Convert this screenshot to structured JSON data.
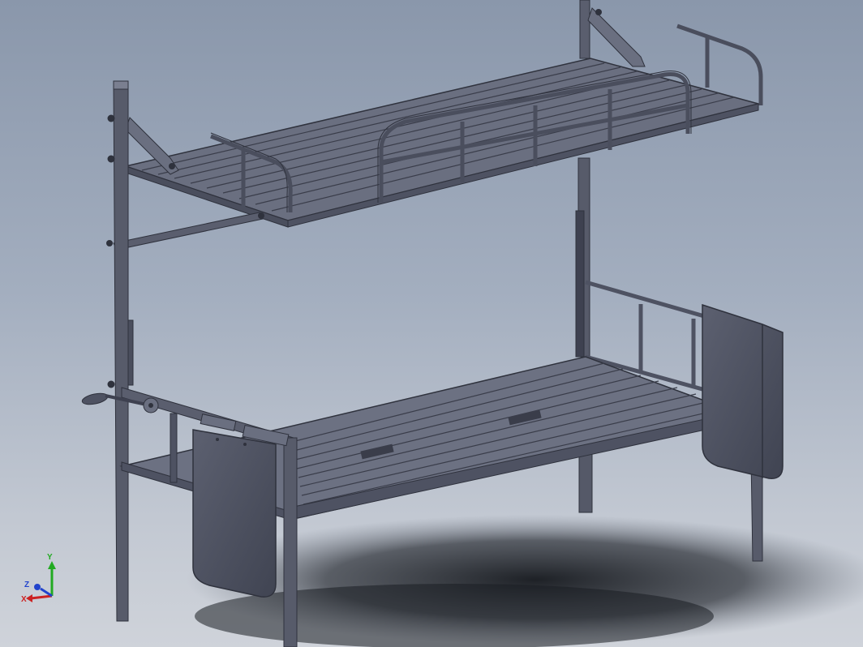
{
  "view": {
    "axes": {
      "y_label": "Y",
      "z_label": "Z",
      "x_label": "X",
      "y_color": "#22aa22",
      "z_color": "#2244cc",
      "x_color": "#cc2222"
    },
    "colors": {
      "metal_dark": "#3e4150",
      "metal_mid": "#5a5e6e",
      "metal_light": "#7a7f90",
      "panel": "#4e5262",
      "shadow": "#1c1f24"
    }
  }
}
